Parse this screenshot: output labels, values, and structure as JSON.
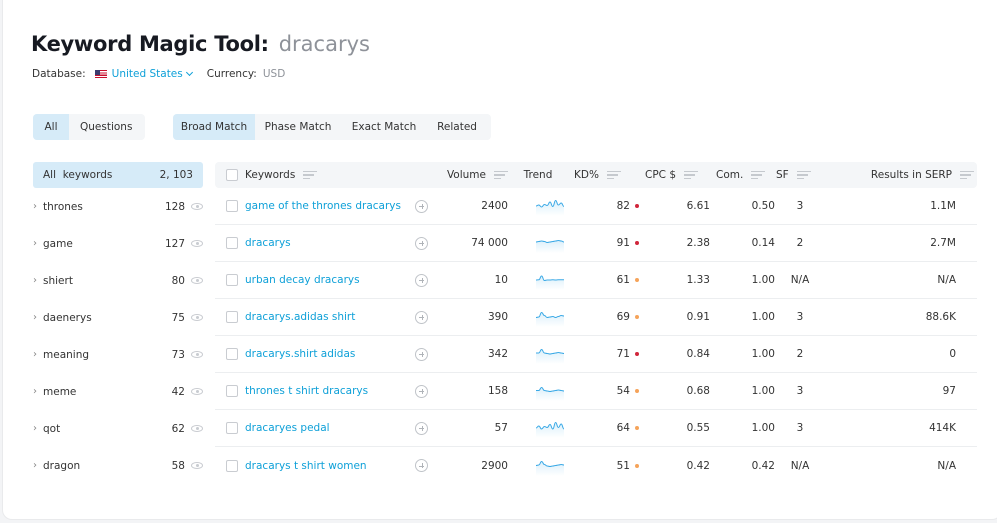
{
  "header": {
    "title": "Keyword Magic Tool:",
    "query": "dracarys",
    "database_label": "Database:",
    "database_value": "United States",
    "currency_label": "Currency:",
    "currency_value": "USD"
  },
  "question_tabs": [
    {
      "label": "All",
      "active": true
    },
    {
      "label": "Questions",
      "active": false
    }
  ],
  "match_tabs": [
    {
      "label": "Broad Match",
      "active": true
    },
    {
      "label": "Phase Match",
      "active": false
    },
    {
      "label": "Exact Match",
      "active": false
    },
    {
      "label": "Related",
      "active": false
    }
  ],
  "sidebar": {
    "head_label": "All  keywords",
    "head_count": "2, 103",
    "groups": [
      {
        "name": "thrones",
        "count": "128"
      },
      {
        "name": "game",
        "count": "127"
      },
      {
        "name": "shiert",
        "count": "80"
      },
      {
        "name": "daenerys",
        "count": "75"
      },
      {
        "name": "meaning",
        "count": "73"
      },
      {
        "name": "meme",
        "count": "42"
      },
      {
        "name": "qot",
        "count": "62"
      },
      {
        "name": "dragon",
        "count": "58"
      }
    ]
  },
  "table": {
    "columns": {
      "keywords": "Keywords",
      "volume": "Volume",
      "trend": "Trend",
      "kd": "KD%",
      "cpc": "CPC $",
      "com": "Com.",
      "sf": "SF",
      "results": "Results in SERP"
    },
    "kd_colors": {
      "high": "#d0253b",
      "medium": "#f5a35a"
    },
    "trend_color": "#3aa9e6",
    "rows": [
      {
        "keyword": "game of the thrones dracarys",
        "volume": "2400",
        "trend": [
          0.4,
          0.5,
          0.3,
          0.55,
          0.45,
          0.8,
          0.35,
          0.95,
          0.5,
          0.7,
          0.35
        ],
        "kd": "82",
        "kd_level": "high",
        "cpc": "6.61",
        "com": "0.50",
        "sf": "3",
        "results": "1.1M"
      },
      {
        "keyword": "dracarys",
        "volume": "74 000",
        "trend": [
          0.5,
          0.55,
          0.6,
          0.55,
          0.45,
          0.5,
          0.55,
          0.6,
          0.65,
          0.6,
          0.5
        ],
        "kd": "91",
        "kd_level": "high",
        "cpc": "2.38",
        "com": "0.14",
        "sf": "2",
        "results": "2.7M"
      },
      {
        "keyword": "urban decay dracarys",
        "volume": "10",
        "trend": [
          0.4,
          0.42,
          0.8,
          0.35,
          0.4,
          0.4,
          0.42,
          0.4,
          0.42,
          0.43,
          0.42
        ],
        "kd": "61",
        "kd_level": "medium",
        "cpc": "1.33",
        "com": "1.00",
        "sf": "N/A",
        "results": "N/A"
      },
      {
        "keyword": "dracarys.adidas shirt",
        "volume": "390",
        "trend": [
          0.35,
          0.4,
          0.85,
          0.55,
          0.35,
          0.4,
          0.45,
          0.35,
          0.45,
          0.55,
          0.5
        ],
        "kd": "69",
        "kd_level": "medium",
        "cpc": "0.91",
        "com": "1.00",
        "sf": "3",
        "results": "88.6K"
      },
      {
        "keyword": "dracarys.shirt adidas",
        "volume": "342",
        "trend": [
          0.5,
          0.5,
          0.85,
          0.5,
          0.45,
          0.4,
          0.45,
          0.5,
          0.55,
          0.5,
          0.45
        ],
        "kd": "71",
        "kd_level": "high",
        "cpc": "0.84",
        "com": "1.00",
        "sf": "2",
        "results": "0"
      },
      {
        "keyword": "thrones t shirt dracarys",
        "volume": "158",
        "trend": [
          0.45,
          0.45,
          0.75,
          0.45,
          0.4,
          0.35,
          0.4,
          0.45,
          0.5,
          0.45,
          0.4
        ],
        "kd": "54",
        "kd_level": "medium",
        "cpc": "0.68",
        "com": "1.00",
        "sf": "3",
        "results": "97"
      },
      {
        "keyword": "dracaryes pedal",
        "volume": "57",
        "trend": [
          0.4,
          0.6,
          0.3,
          0.55,
          0.45,
          0.75,
          0.3,
          0.95,
          0.45,
          0.8,
          0.3
        ],
        "kd": "64",
        "kd_level": "medium",
        "cpc": "0.55",
        "com": "1.00",
        "sf": "3",
        "results": "414K"
      },
      {
        "keyword": "dracarys t shirt women",
        "volume": "2900",
        "trend": [
          0.45,
          0.5,
          0.85,
          0.55,
          0.4,
          0.35,
          0.4,
          0.45,
          0.5,
          0.55,
          0.5
        ],
        "kd": "51",
        "kd_level": "medium",
        "cpc": "0.42",
        "com": "0.42",
        "sf": "N/A",
        "results": "N/A"
      }
    ]
  }
}
